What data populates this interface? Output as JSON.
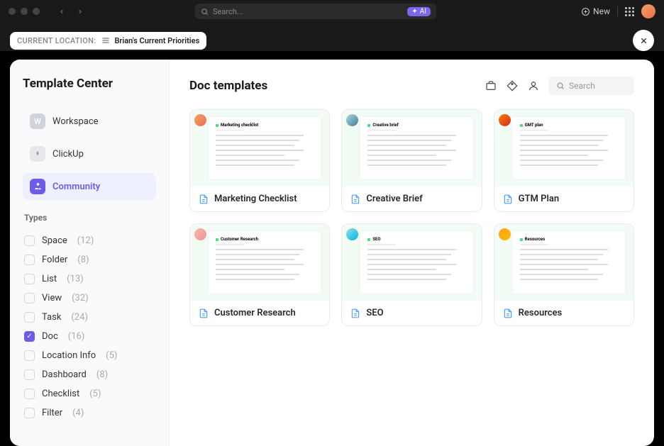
{
  "titlebar": {
    "search_placeholder": "Search...",
    "ai_label": "AI",
    "new_label": "New"
  },
  "breadcrumb": {
    "label": "CURRENT LOCATION:",
    "value": "Brian's Current Priorities"
  },
  "sidebar": {
    "title": "Template Center",
    "sources": [
      {
        "label": "Workspace",
        "icon": "W",
        "active": false
      },
      {
        "label": "ClickUp",
        "icon": "",
        "active": false
      },
      {
        "label": "Community",
        "icon": "",
        "active": true
      }
    ],
    "types_label": "Types",
    "types": [
      {
        "label": "Space",
        "count": "(12)",
        "checked": false
      },
      {
        "label": "Folder",
        "count": "(8)",
        "checked": false
      },
      {
        "label": "List",
        "count": "(13)",
        "checked": false
      },
      {
        "label": "View",
        "count": "(32)",
        "checked": false
      },
      {
        "label": "Task",
        "count": "(24)",
        "checked": false
      },
      {
        "label": "Doc",
        "count": "(16)",
        "checked": true
      },
      {
        "label": "Location Info",
        "count": "(5)",
        "checked": false
      },
      {
        "label": "Dashboard",
        "count": "(8)",
        "checked": false
      },
      {
        "label": "Checklist",
        "count": "(5)",
        "checked": false
      },
      {
        "label": "Filter",
        "count": "(4)",
        "checked": false
      }
    ]
  },
  "content": {
    "title": "Doc templates",
    "search_placeholder": "Search",
    "templates": [
      {
        "name": "Marketing Checklist",
        "preview_title": "Marketing checklist",
        "avatar": "avatar-1"
      },
      {
        "name": "Creative Brief",
        "preview_title": "Creative brief",
        "avatar": "avatar-2"
      },
      {
        "name": "GTM Plan",
        "preview_title": "GMT plan",
        "avatar": "avatar-3"
      },
      {
        "name": "Customer Research",
        "preview_title": "Customer Research",
        "avatar": "avatar-4"
      },
      {
        "name": "SEO",
        "preview_title": "SEO",
        "avatar": "avatar-5"
      },
      {
        "name": "Resources",
        "preview_title": "Resources",
        "avatar": "avatar-6"
      }
    ]
  }
}
